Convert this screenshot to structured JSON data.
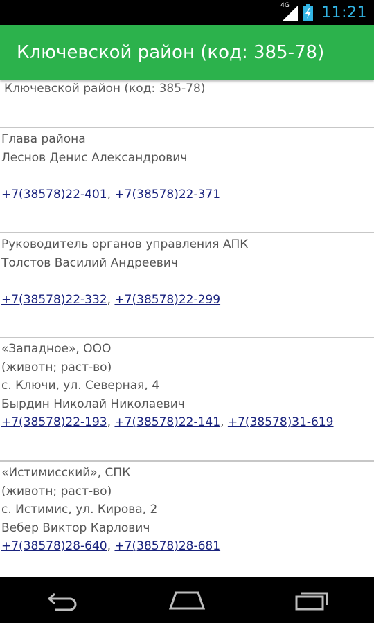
{
  "status_bar": {
    "network_label": "4G",
    "time": "11:21",
    "icons": [
      "signal-icon",
      "battery-charging-icon"
    ]
  },
  "action_bar": {
    "title": "Ключевской район (код: 385-78)"
  },
  "content": {
    "header": "Ключевской район (код: 385-78)",
    "sections": [
      {
        "lines": [
          "Глава района",
          "Леснов Денис Александрович"
        ],
        "blank_before_phones": true,
        "phones": [
          "+7(38578)22-401",
          "+7(38578)22-371"
        ]
      },
      {
        "lines": [
          "Руководитель органов управления АПК",
          "Толстов Василий Андреевич"
        ],
        "blank_before_phones": true,
        "phones": [
          "+7(38578)22-332",
          "+7(38578)22-299"
        ]
      },
      {
        "lines": [
          "«Западное», ООО",
          "(животн; раст-во)",
          "с. Ключи, ул. Северная, 4",
          "Бырдин Николай Николаевич"
        ],
        "blank_before_phones": false,
        "phones": [
          "+7(38578)22-193",
          "+7(38578)22-141",
          "+7(38578)31-619"
        ]
      },
      {
        "lines": [
          "«Истимисский», СПК",
          "(животн; раст-во)",
          "с. Истимис, ул. Кирова, 2",
          "Вебер Виктор Карлович"
        ],
        "blank_before_phones": false,
        "phones": [
          "+7(38578)28-640",
          "+7(38578)28-681"
        ]
      }
    ],
    "phone_separator": ", "
  },
  "nav_bar": {
    "buttons": [
      "back-icon",
      "home-icon",
      "recent-apps-icon"
    ]
  },
  "colors": {
    "action_bar": "#2cb24c",
    "clock": "#33b5e5",
    "link": "#1a237e",
    "divider": "#c7c7c7"
  }
}
